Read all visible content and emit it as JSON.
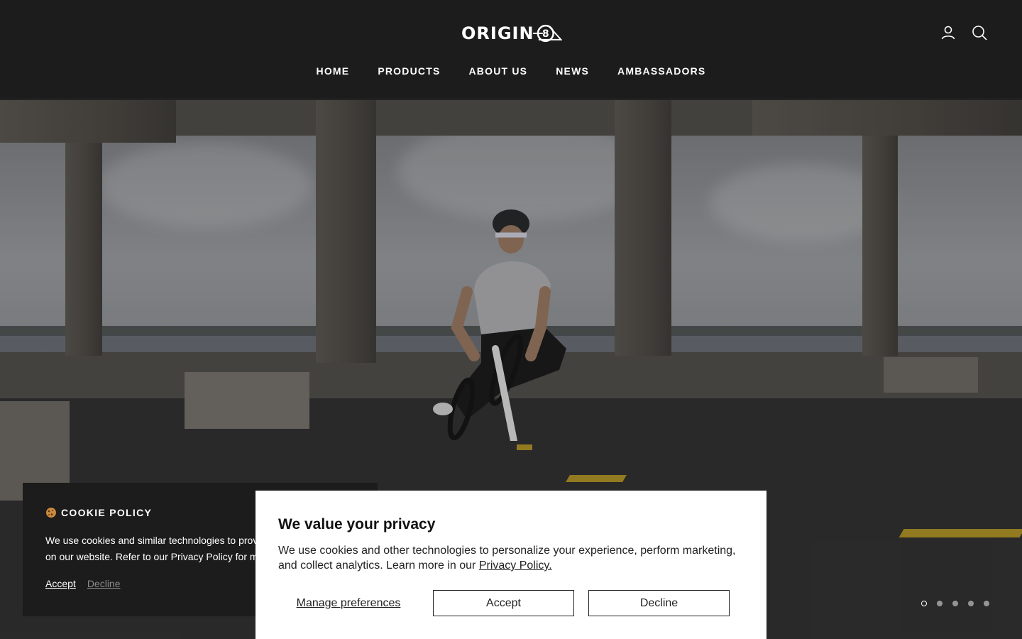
{
  "header": {
    "logo_text": "ORIGIN",
    "nav": [
      {
        "label": "HOME"
      },
      {
        "label": "PRODUCTS"
      },
      {
        "label": "ABOUT US"
      },
      {
        "label": "NEWS"
      },
      {
        "label": "AMBASSADORS"
      }
    ],
    "icons": [
      "account-icon",
      "search-icon"
    ]
  },
  "hero": {
    "slides_count": 5,
    "active_slide": 1
  },
  "cookie_policy": {
    "icon": "cookie-icon",
    "title": "COOKIE POLICY",
    "line1": "We use cookies and similar technologies to provid",
    "line2": "on our website. Refer to our Privacy Policy for mo",
    "accept_label": "Accept",
    "decline_label": "Decline"
  },
  "privacy_modal": {
    "title": "We value your privacy",
    "text": "We use cookies and other technologies to personalize your experience, perform marketing, and collect analytics. Learn more in our ",
    "link_label": "Privacy Policy.",
    "manage_label": "Manage preferences",
    "accept_label": "Accept",
    "decline_label": "Decline"
  }
}
